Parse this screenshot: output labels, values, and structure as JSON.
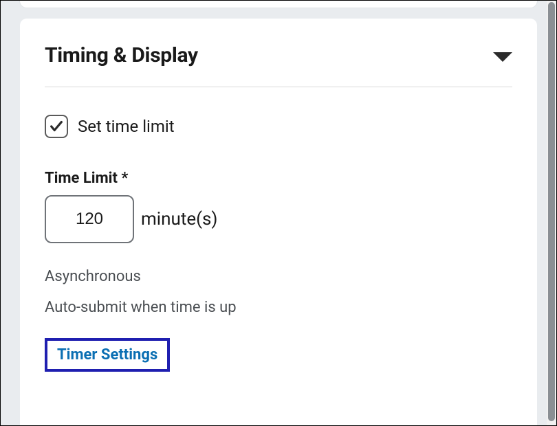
{
  "section": {
    "title": "Timing & Display"
  },
  "setTimeLimit": {
    "label": "Set time limit",
    "checked": true
  },
  "timeLimit": {
    "label": "Time Limit *",
    "value": "120",
    "suffix": "minute(s)"
  },
  "info": {
    "line1": "Asynchronous",
    "line2": "Auto-submit when time is up"
  },
  "timerSettings": {
    "label": "Timer Settings"
  }
}
